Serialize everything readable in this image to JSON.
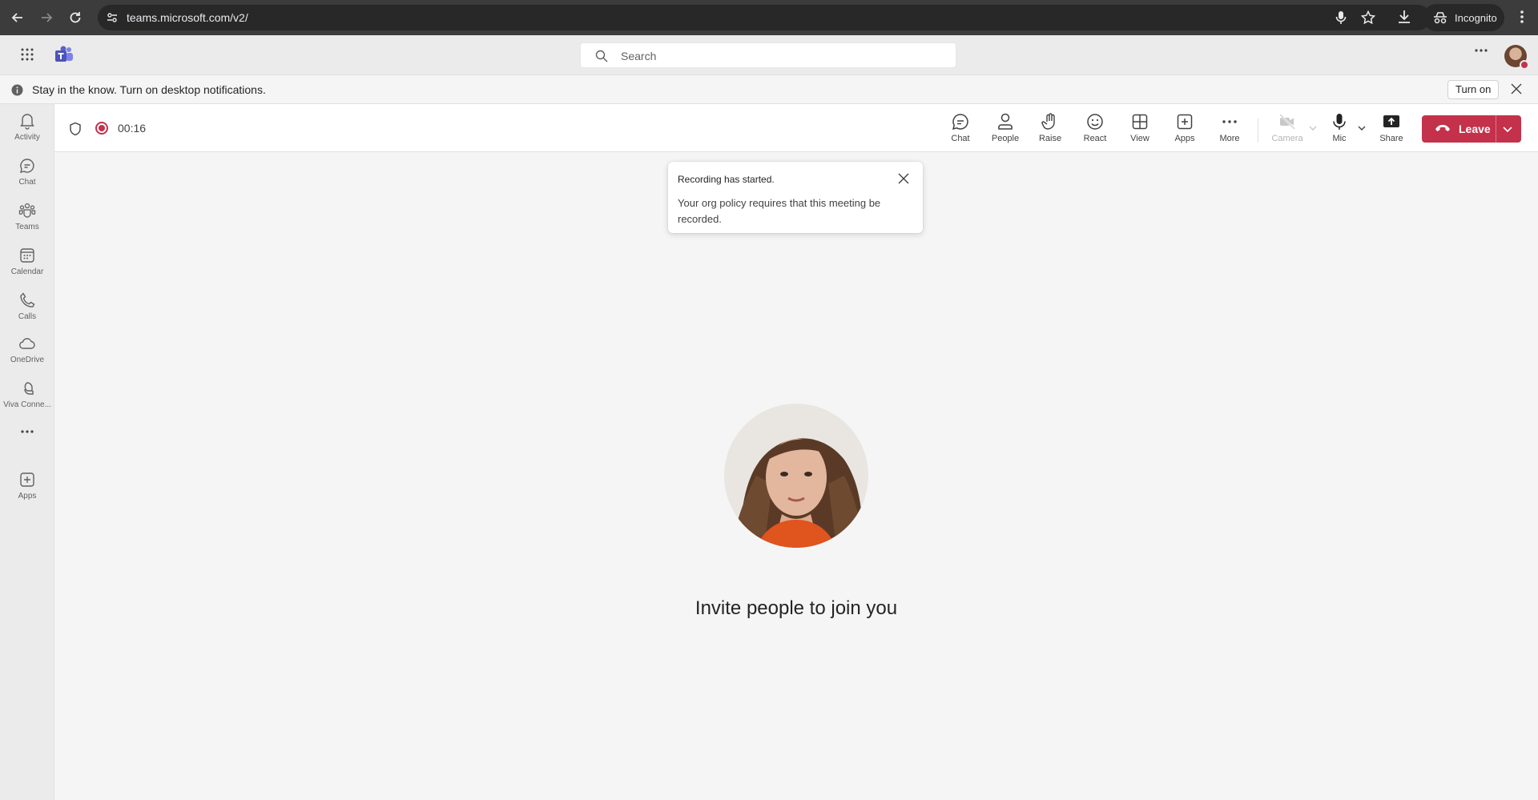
{
  "browser": {
    "url": "teams.microsoft.com/v2/",
    "incognito_label": "Incognito"
  },
  "teams_header": {
    "search_placeholder": "Search"
  },
  "banner": {
    "message": "Stay in the know. Turn on desktop notifications.",
    "turn_on_label": "Turn on"
  },
  "rail": {
    "items": [
      {
        "label": "Activity",
        "icon": "bell-icon"
      },
      {
        "label": "Chat",
        "icon": "chat-icon"
      },
      {
        "label": "Teams",
        "icon": "teams-icon"
      },
      {
        "label": "Calendar",
        "icon": "calendar-icon"
      },
      {
        "label": "Calls",
        "icon": "phone-icon"
      },
      {
        "label": "OneDrive",
        "icon": "cloud-icon"
      },
      {
        "label": "Viva Conne...",
        "icon": "viva-icon"
      },
      {
        "label": "Apps",
        "icon": "add-app-icon"
      }
    ]
  },
  "meeting": {
    "timer": "00:16",
    "toolbar": {
      "chat": "Chat",
      "people": "People",
      "raise": "Raise",
      "react": "React",
      "view": "View",
      "apps": "Apps",
      "more": "More",
      "camera": "Camera",
      "mic": "Mic",
      "share": "Share",
      "leave": "Leave"
    }
  },
  "toast": {
    "title": "Recording has started.",
    "body": "Your org policy requires that this meeting be recorded."
  },
  "stage": {
    "invite_text": "Invite people to join you"
  },
  "colors": {
    "accent_leave": "#c4314b",
    "teams_brand": "#5b5fc7",
    "recording": "#c4314b"
  }
}
